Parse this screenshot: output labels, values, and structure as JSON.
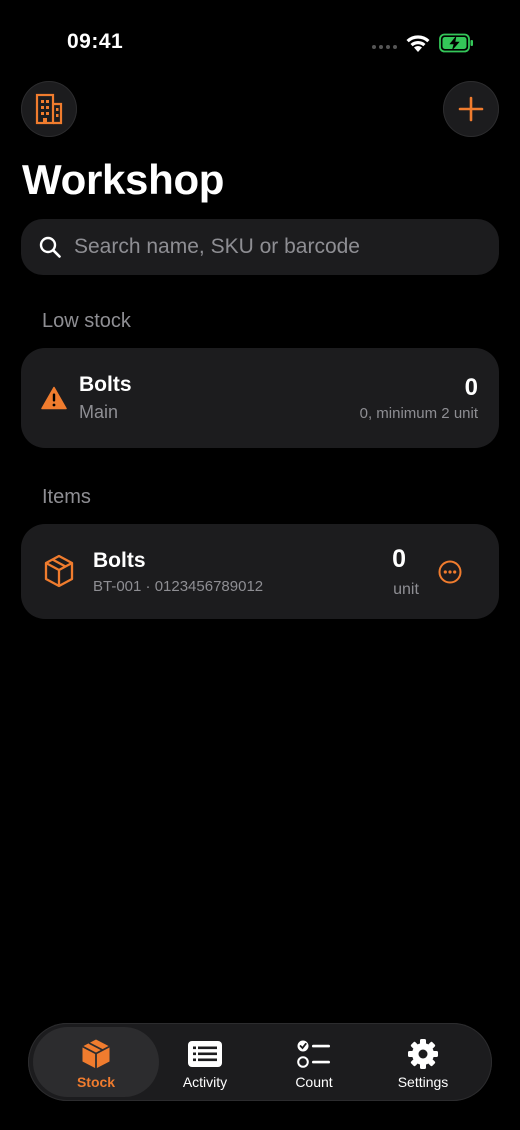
{
  "status_bar": {
    "time": "09:41"
  },
  "header": {
    "title": "Workshop"
  },
  "search": {
    "placeholder": "Search name, SKU or barcode"
  },
  "low_stock": {
    "header": "Low stock",
    "items": [
      {
        "name": "Bolts",
        "location": "Main",
        "quantity": "0",
        "detail": "0, minimum 2 unit"
      }
    ]
  },
  "items": {
    "header": "Items",
    "list": [
      {
        "name": "Bolts",
        "meta": "BT-001 · 0123456789012",
        "quantity": "0",
        "unit": "unit"
      }
    ]
  },
  "tab_bar": {
    "tabs": [
      {
        "label": "Stock",
        "icon": "box-icon",
        "active": true
      },
      {
        "label": "Activity",
        "icon": "list-icon",
        "active": false
      },
      {
        "label": "Count",
        "icon": "checklist-icon",
        "active": false
      },
      {
        "label": "Settings",
        "icon": "gear-icon",
        "active": false
      }
    ]
  },
  "colors": {
    "accent": "#f07c2e",
    "card": "#1c1c1e",
    "background": "#000000",
    "secondary_text": "#8e8e93",
    "battery": "#34c759"
  }
}
